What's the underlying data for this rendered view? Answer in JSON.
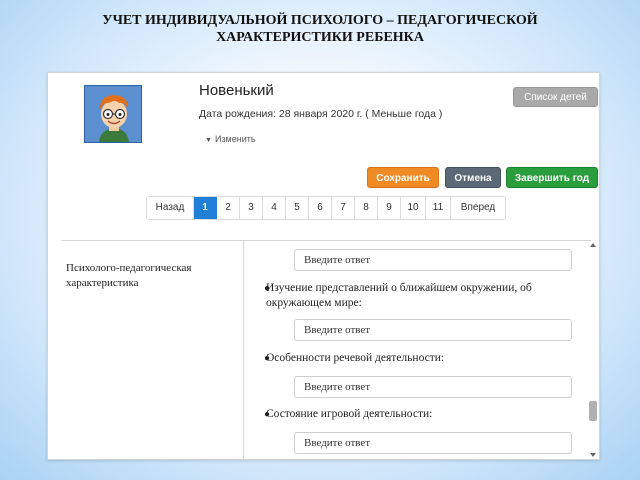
{
  "slide": {
    "title_line1": "УЧЕТ ИНДИВИДУАЛЬНОЙ ПСИХОЛОГО – ПЕДАГОГИЧЕСКОЙ",
    "title_line2": "ХАРАКТЕРИСТИКИ РЕБЕНКА"
  },
  "profile": {
    "avatar_icon": "boy-avatar-icon",
    "name": "Новенький",
    "birth_text": "Дата рождения: 28 января 2020 г. ( Меньше года )",
    "edit_label": "Изменить"
  },
  "header": {
    "children_list_label": "Список детей"
  },
  "toolbar": {
    "save_label": "Сохранить",
    "cancel_label": "Отмена",
    "finish_year_label": "Завершить год",
    "colors": {
      "save": "#f08a24",
      "cancel": "#5a6975",
      "finish": "#2a9d3c"
    }
  },
  "pagination": {
    "prev_label": "Назад",
    "pages": [
      "1",
      "2",
      "3",
      "4",
      "5",
      "6",
      "7",
      "8",
      "9",
      "10",
      "11"
    ],
    "active_page": "1",
    "next_label": "Вперед",
    "active_color": "#1f7fd6"
  },
  "section": {
    "label": "Психолого-педагогическая характеристика"
  },
  "form": {
    "input_placeholder": "Введите ответ",
    "questions": [
      "Изучение представлений о ближайшем окружении, об окружающем мире:",
      "Особенности речевой деятельности:",
      "Состояние игровой деятельности:"
    ]
  }
}
